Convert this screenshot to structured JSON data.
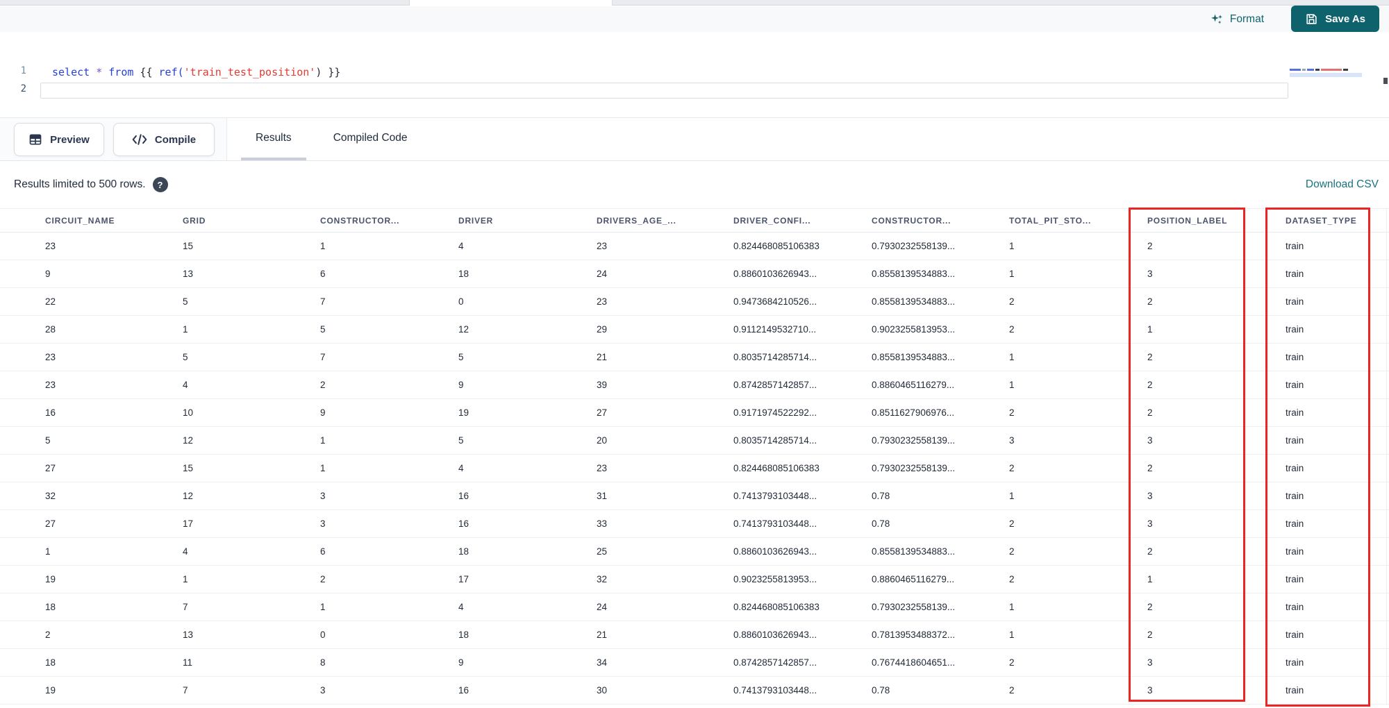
{
  "toolbar": {
    "format_label": "Format",
    "save_as_label": "Save As"
  },
  "editor": {
    "line_numbers": [
      "1",
      "2"
    ],
    "lines": [
      {
        "tokens": [
          {
            "t": "select",
            "c": "kw"
          },
          {
            "t": " ",
            "c": "punct"
          },
          {
            "t": "*",
            "c": "op"
          },
          {
            "t": " ",
            "c": "punct"
          },
          {
            "t": "from",
            "c": "kw"
          },
          {
            "t": " {{ ",
            "c": "punct"
          },
          {
            "t": "ref(",
            "c": "fn"
          },
          {
            "t": "'train_test_position'",
            "c": "str"
          },
          {
            "t": ")",
            "c": "punct"
          },
          {
            "t": " }}",
            "c": "punct"
          }
        ]
      },
      {
        "tokens": []
      }
    ]
  },
  "panel": {
    "preview_label": "Preview",
    "compile_label": "Compile",
    "tabs": [
      {
        "label": "Results",
        "active": true
      },
      {
        "label": "Compiled Code",
        "active": false
      }
    ],
    "results_note": "Results limited to 500 rows.",
    "help_glyph": "?",
    "download_csv_label": "Download CSV"
  },
  "icons": {
    "format": "sparkles-icon",
    "save_as": "floppy-disk-icon",
    "preview": "table-grid-icon",
    "compile": "code-brackets-icon",
    "results_note": "question-mark-circle-icon"
  },
  "colors": {
    "accent_teal": "#0e626c",
    "teal_text": "#12636d",
    "link_teal": "#19727f",
    "highlight_red": "#ee2423",
    "syntax_keyword": "#2740d6",
    "syntax_operator": "#7b51c6",
    "syntax_string": "#e23a31",
    "syntax_plain": "#262b33"
  },
  "table": {
    "columns": [
      "CIRCUIT_NAME",
      "GRID",
      "CONSTRUCTOR...",
      "DRIVER",
      "DRIVERS_AGE_...",
      "DRIVER_CONFI...",
      "CONSTRUCTOR...",
      "TOTAL_PIT_STO...",
      "POSITION_LABEL",
      "DATASET_TYPE"
    ],
    "highlighted_columns": [
      "POSITION_LABEL",
      "DATASET_TYPE"
    ],
    "rows": [
      [
        "23",
        "15",
        "1",
        "4",
        "23",
        "0.824468085106383",
        "0.7930232558139...",
        "1",
        "2",
        "train"
      ],
      [
        "9",
        "13",
        "6",
        "18",
        "24",
        "0.8860103626943...",
        "0.8558139534883...",
        "1",
        "3",
        "train"
      ],
      [
        "22",
        "5",
        "7",
        "0",
        "23",
        "0.9473684210526...",
        "0.8558139534883...",
        "2",
        "2",
        "train"
      ],
      [
        "28",
        "1",
        "5",
        "12",
        "29",
        "0.9112149532710...",
        "0.9023255813953...",
        "2",
        "1",
        "train"
      ],
      [
        "23",
        "5",
        "7",
        "5",
        "21",
        "0.8035714285714...",
        "0.8558139534883...",
        "1",
        "2",
        "train"
      ],
      [
        "23",
        "4",
        "2",
        "9",
        "39",
        "0.8742857142857...",
        "0.8860465116279...",
        "1",
        "2",
        "train"
      ],
      [
        "16",
        "10",
        "9",
        "19",
        "27",
        "0.9171974522292...",
        "0.8511627906976...",
        "2",
        "2",
        "train"
      ],
      [
        "5",
        "12",
        "1",
        "5",
        "20",
        "0.8035714285714...",
        "0.7930232558139...",
        "3",
        "3",
        "train"
      ],
      [
        "27",
        "15",
        "1",
        "4",
        "23",
        "0.824468085106383",
        "0.7930232558139...",
        "2",
        "2",
        "train"
      ],
      [
        "32",
        "12",
        "3",
        "16",
        "31",
        "0.7413793103448...",
        "0.78",
        "1",
        "3",
        "train"
      ],
      [
        "27",
        "17",
        "3",
        "16",
        "33",
        "0.7413793103448...",
        "0.78",
        "2",
        "3",
        "train"
      ],
      [
        "1",
        "4",
        "6",
        "18",
        "25",
        "0.8860103626943...",
        "0.8558139534883...",
        "2",
        "2",
        "train"
      ],
      [
        "19",
        "1",
        "2",
        "17",
        "32",
        "0.9023255813953...",
        "0.8860465116279...",
        "2",
        "1",
        "train"
      ],
      [
        "18",
        "7",
        "1",
        "4",
        "24",
        "0.824468085106383",
        "0.7930232558139...",
        "1",
        "2",
        "train"
      ],
      [
        "2",
        "13",
        "0",
        "18",
        "21",
        "0.8860103626943...",
        "0.7813953488372...",
        "1",
        "2",
        "train"
      ],
      [
        "18",
        "11",
        "8",
        "9",
        "34",
        "0.8742857142857...",
        "0.7674418604651...",
        "2",
        "3",
        "train"
      ],
      [
        "19",
        "7",
        "3",
        "16",
        "30",
        "0.7413793103448...",
        "0.78",
        "2",
        "3",
        "train"
      ]
    ]
  }
}
